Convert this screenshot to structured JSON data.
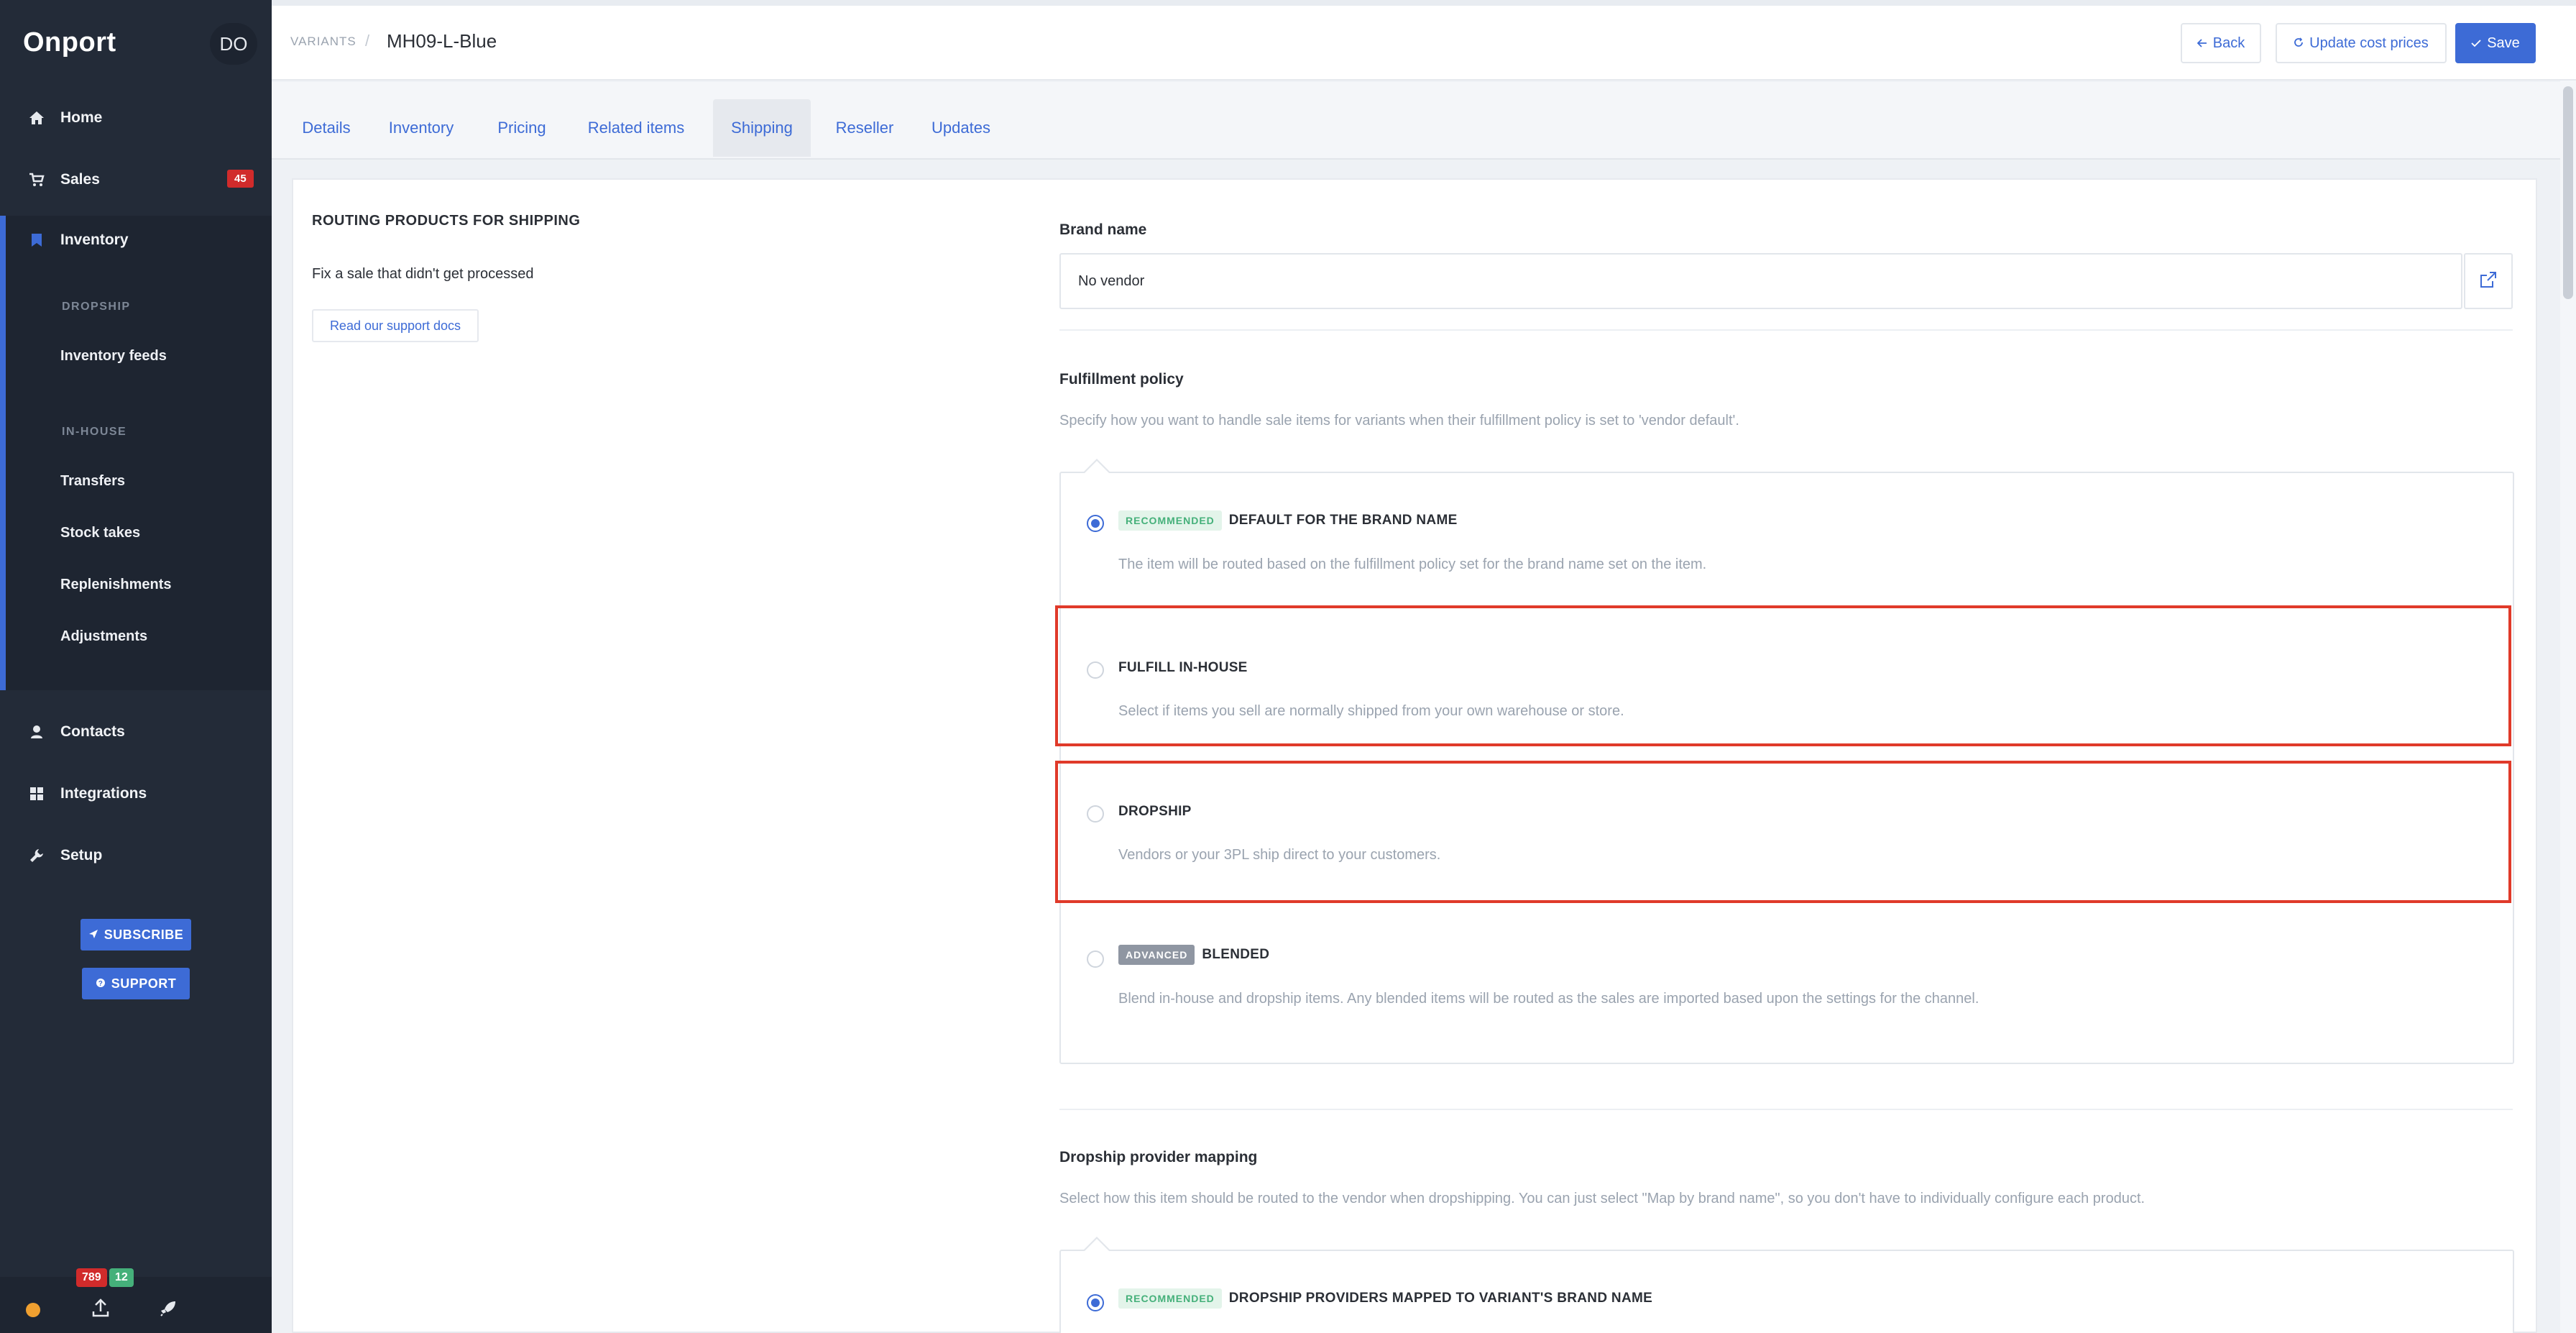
{
  "app": {
    "brand": "Onport",
    "avatar_initials": "DO"
  },
  "sidebar": {
    "nav": [
      {
        "label": "Home",
        "icon": "home-icon"
      },
      {
        "label": "Sales",
        "icon": "cart-icon",
        "badge": "45"
      },
      {
        "label": "Inventory",
        "icon": "bookmark-icon"
      },
      {
        "label": "Contacts",
        "icon": "person-icon"
      },
      {
        "label": "Integrations",
        "icon": "grid-icon"
      },
      {
        "label": "Setup",
        "icon": "wrench-icon"
      }
    ],
    "inventory_sections": [
      {
        "heading": "DROPSHIP",
        "items": [
          "Inventory feeds"
        ]
      },
      {
        "heading": "IN-HOUSE",
        "items": [
          "Transfers",
          "Stock takes",
          "Replenishments",
          "Adjustments"
        ]
      }
    ],
    "subscribe_label": "SUBSCRIBE",
    "support_label": "SUPPORT",
    "bottom_counts": {
      "red": "789",
      "green": "12"
    }
  },
  "header": {
    "breadcrumb_parent": "VARIANTS",
    "breadcrumb_sep": "/",
    "title": "MH09-L-Blue",
    "back_label": "Back",
    "update_cost_label": "Update cost prices",
    "save_label": "Save"
  },
  "tabs": {
    "items": [
      "Details",
      "Inventory",
      "Pricing",
      "Related items",
      "Shipping",
      "Reseller",
      "Updates"
    ],
    "active": "Shipping"
  },
  "left": {
    "title": "ROUTING PRODUCTS FOR SHIPPING",
    "text": "Fix a sale that didn't get processed",
    "docs_label": "Read our support docs"
  },
  "brand": {
    "label": "Brand name",
    "value": "No vendor"
  },
  "fulfillment": {
    "label": "Fulfillment policy",
    "help": "Specify how you want to handle sale items for variants when their fulfillment policy is set to 'vendor default'.",
    "options": [
      {
        "tag": "RECOMMENDED",
        "title": "DEFAULT FOR THE BRAND NAME",
        "desc": "The item will be routed based on the fulfillment policy set for the brand name set on the item.",
        "selected": true
      },
      {
        "tag": "",
        "title": "FULFILL IN-HOUSE",
        "desc": "Select if items you sell are normally shipped from your own warehouse or store.",
        "selected": false
      },
      {
        "tag": "",
        "title": "DROPSHIP",
        "desc": "Vendors or your 3PL ship direct to your customers.",
        "selected": false
      },
      {
        "tag": "ADVANCED",
        "title": "BLENDED",
        "desc": "Blend in-house and dropship items. Any blended items will be routed as the sales are imported based upon the settings for the channel.",
        "selected": false
      }
    ]
  },
  "dropship_mapping": {
    "label": "Dropship provider mapping",
    "help": "Select how this item should be routed to the vendor when dropshipping. You can just select \"Map by brand name\", so you don't have to individually configure each product.",
    "options": [
      {
        "tag": "RECOMMENDED",
        "title": "DROPSHIP PROVIDERS MAPPED TO VARIANT'S BRAND NAME",
        "selected": true
      }
    ]
  },
  "colors": {
    "accent": "#3d6bd6",
    "sidebar": "#232b38",
    "highlight": "#e03a2a",
    "badge_red": "#d12b2b",
    "badge_green": "#45b07a"
  }
}
